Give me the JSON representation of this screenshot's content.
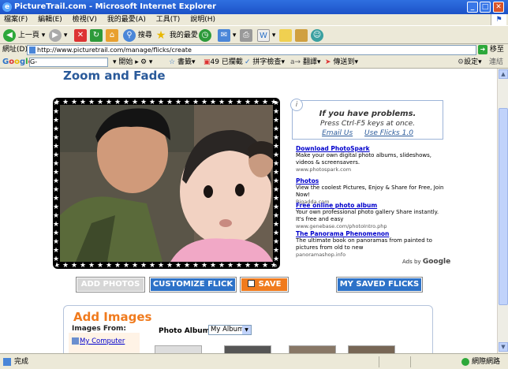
{
  "window": {
    "title": "PictureTrail.com - Microsoft Internet Explorer",
    "min": "_",
    "max": "□",
    "close": "✕"
  },
  "menu": [
    "檔案(F)",
    "編輯(E)",
    "檢視(V)",
    "我的最愛(A)",
    "工具(T)",
    "說明(H)"
  ],
  "toolbar": {
    "back": "上一頁",
    "search": "搜尋",
    "favorites": "我的最愛"
  },
  "address": {
    "label": "網址(D)",
    "url": "http://www.picturetrail.com/manage/flicks/create",
    "go": "移至"
  },
  "googlebar": {
    "logo": "Google",
    "search_prefix": "G-",
    "start": "開始",
    "bookmarks": "書籤",
    "blocked": "49 已攔截",
    "spell": "拼字檢查",
    "translate": "翻譯",
    "send": "傳送到",
    "settings": "設定",
    "links": "連結"
  },
  "page": {
    "title": "Zoom and Fade",
    "info": {
      "line1": "If you have problems.",
      "line2": "Press Ctrl-F5 keys at once.",
      "link1": "Email Us",
      "link2": "Use Flicks 1.0"
    },
    "ads": [
      {
        "title": "Download PhotoSpark",
        "text": "Make your own digital photo albums, slideshows, videos & screensavers.",
        "url": "www.photospark.com"
      },
      {
        "title": "Photos",
        "text": "View the coolest Pictures, Enjoy & Share for Free, Join Now!",
        "url": "Bigadda.com"
      },
      {
        "title": "Free online photo album",
        "text": "Your own professional photo gallery Share instantly. It's free and easy",
        "url": "www.genebase.com/photoIntro.php"
      },
      {
        "title": "The Panorama Phenomenon",
        "text": "The ultimate book on panoramas from painted to pictures from old to new",
        "url": "panoramashop.info"
      }
    ],
    "ads_by": "Ads by",
    "ads_brand": "Google",
    "buttons": {
      "add_photos": "ADD PHOTOS",
      "customize": "CUSTOMIZE FLICK",
      "save": "SAVE",
      "my_flicks": "MY SAVED FLICKS"
    },
    "add_images": {
      "title": "Add Images",
      "images_from": "Images From:",
      "my_computer": "My Computer",
      "album_label": "Photo Album:",
      "album_value": "My Album"
    }
  },
  "status": {
    "text": "完成",
    "zone": "網際網路"
  }
}
